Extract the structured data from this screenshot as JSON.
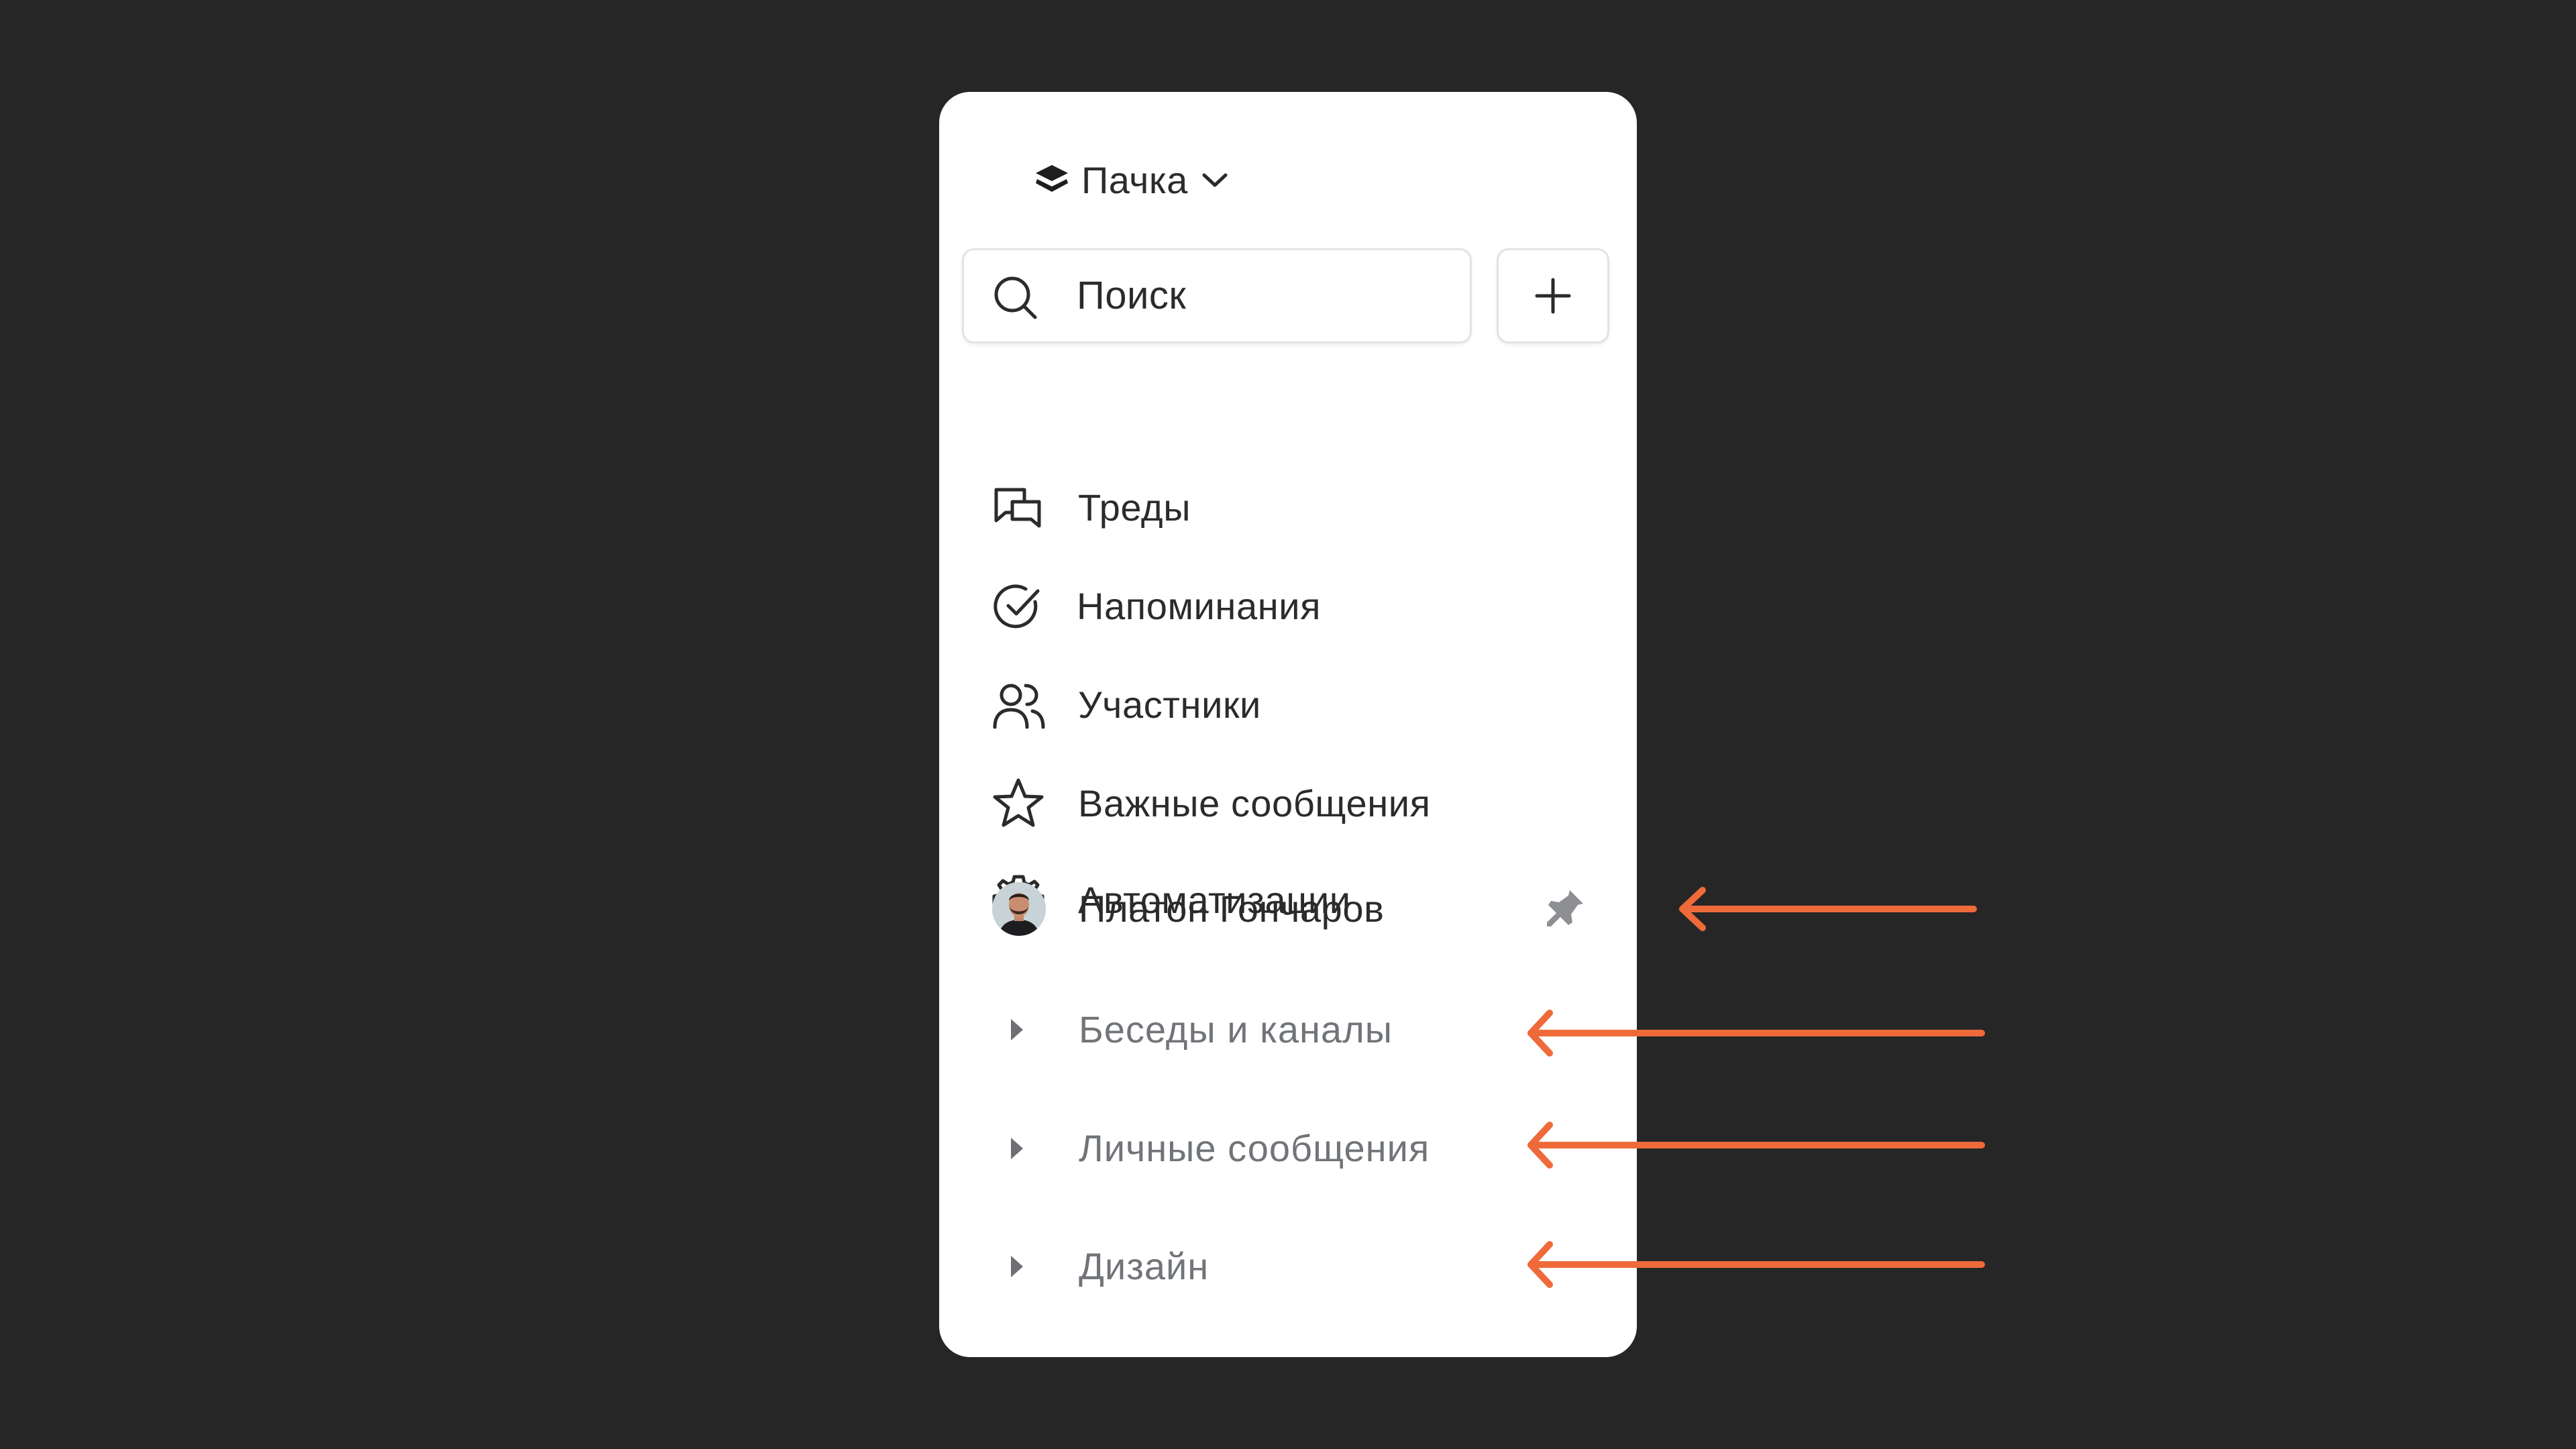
{
  "workspace": {
    "name": "Пачка",
    "icon": "layers-icon",
    "dropdown_icon": "chevron-down-icon"
  },
  "search": {
    "placeholder": "Поиск",
    "icon": "search-icon"
  },
  "add_button": {
    "icon": "plus-icon"
  },
  "nav": [
    {
      "label": "Треды",
      "icon": "threads-icon"
    },
    {
      "label": "Напоминания",
      "icon": "check-circle-icon"
    },
    {
      "label": "Участники",
      "icon": "users-icon"
    },
    {
      "label": "Важные сообщения",
      "icon": "star-icon"
    },
    {
      "label": "Автоматизации",
      "icon": "gear-icon"
    }
  ],
  "pinned_contact": {
    "name": "Платон Гончаров",
    "icon": "pin-icon"
  },
  "sections": [
    {
      "label": "Беседы и каналы",
      "icon": "caret-right-icon"
    },
    {
      "label": "Личные сообщения",
      "icon": "caret-right-icon"
    },
    {
      "label": "Дизайн",
      "icon": "caret-right-icon"
    }
  ],
  "colors": {
    "background": "#262626",
    "panel": "#ffffff",
    "accent_arrow": "#ef6a3a",
    "text": "#2b2b2b",
    "muted_text": "#717478"
  }
}
